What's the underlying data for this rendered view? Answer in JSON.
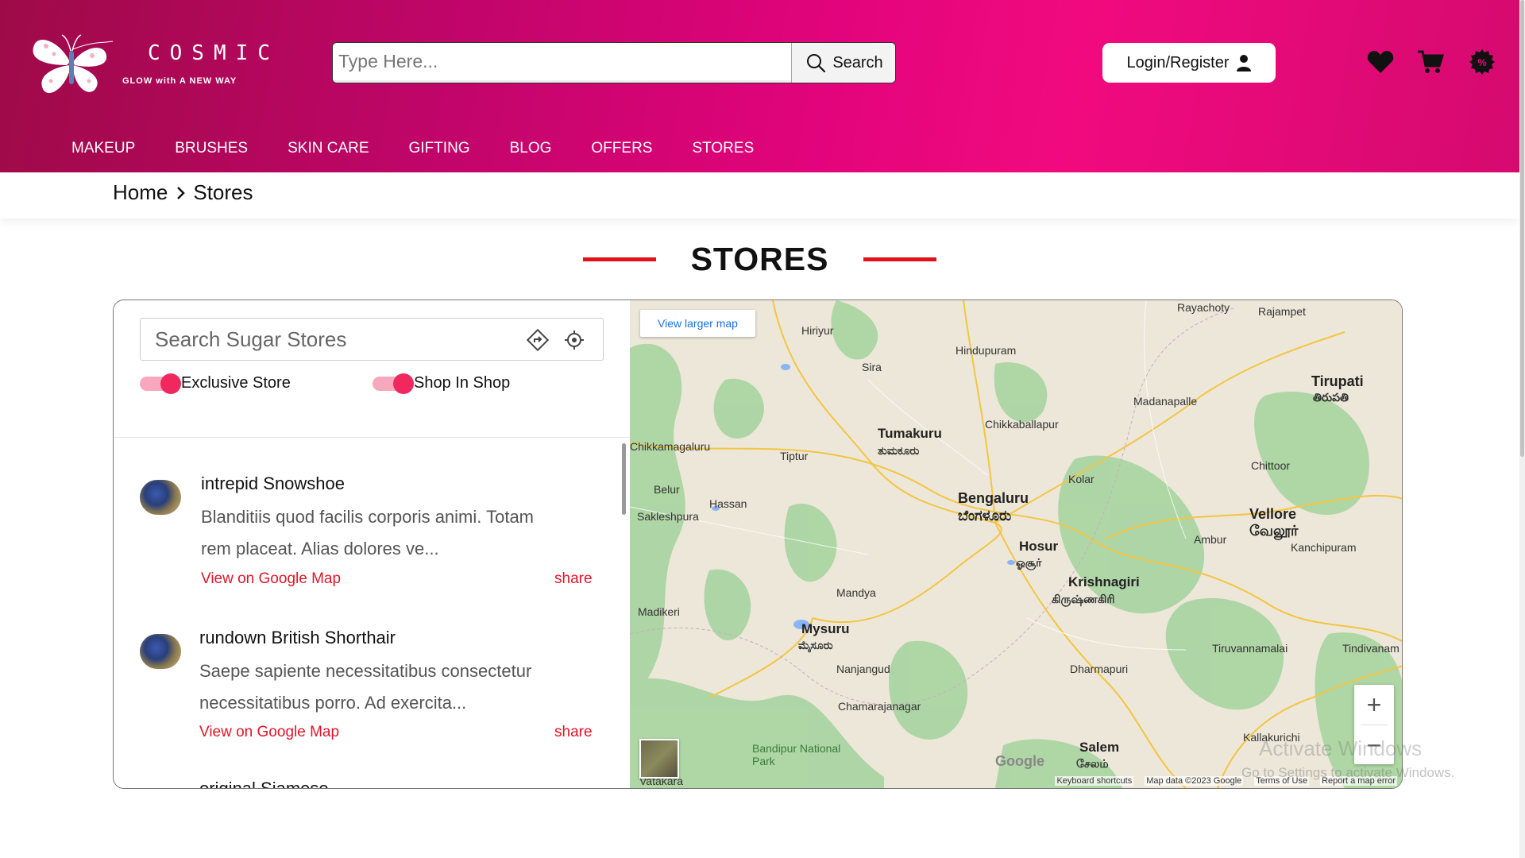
{
  "brand": {
    "name": "COSMIC",
    "tagline": "GLOW with A NEW WAY"
  },
  "header": {
    "search_placeholder": "Type Here...",
    "search_button": "Search",
    "login_label": "Login/Register",
    "icons": [
      "heart-icon",
      "cart-icon",
      "offer-percent-icon"
    ]
  },
  "nav": {
    "items": [
      "MAKEUP",
      "BRUSHES",
      "SKIN CARE",
      "GIFTING",
      "BLOG",
      "OFFERS",
      "STORES"
    ]
  },
  "breadcrumb": {
    "home": "Home",
    "current": "Stores"
  },
  "page": {
    "title": "STORES"
  },
  "store_panel": {
    "search_placeholder": "Search Sugar Stores",
    "toggles": [
      {
        "label": "Exclusive Store",
        "on": true
      },
      {
        "label": "Shop In Shop",
        "on": true
      }
    ],
    "stores": [
      {
        "name": "intrepid Snowshoe",
        "description": "Blanditiis quod facilis corporis animi. Totam rem placeat. Alias dolores ve...",
        "map_link": "View on Google Map",
        "share": "share"
      },
      {
        "name": "rundown British Shorthair",
        "description": "Saepe sapiente necessitatibus consectetur necessitatibus porro. Ad exercita...",
        "map_link": "View on Google Map",
        "share": "share"
      }
    ],
    "partial_next_store": "original Siamese"
  },
  "map": {
    "view_larger": "View larger map",
    "labels": {
      "bengaluru": "Bengaluru",
      "bengaluru_local": "ಬೆಂಗಳೂರು",
      "tumakuru": "Tumakuru",
      "tumakuru_local": "ತುಮಕೂರು",
      "hosur": "Hosur",
      "hosur_local": "ஓசூர்",
      "krishnagiri": "Krishnagiri",
      "krishnagiri_local": "கிருஷ்ணகிரி",
      "mysuru": "Mysuru",
      "mysuru_local": "ಮೈಸೂರು",
      "vellore": "Vellore",
      "vellore_local": "வேலூர்",
      "tirupati": "Tirupati",
      "tirupati_local": "తిరుపతి",
      "salem": "Salem",
      "salem_local": "சேலம்",
      "hiriyur": "Hiriyur",
      "hindupuram": "Hindupuram",
      "chikkaballapur": "Chikkaballapur",
      "kolar": "Kolar",
      "madanapalle": "Madanapalle",
      "tiptur": "Tiptur",
      "hassan": "Hassan",
      "chikkamagaluru": "Chikkamagaluru",
      "mandya": "Mandya",
      "madikeri": "Madikeri",
      "nanjangud": "Nanjangud",
      "chamarajanagar": "Chamarajanagar",
      "dharmapuri": "Dharmapuri",
      "ambur": "Ambur",
      "chittoor": "Chittoor",
      "kanchipuram": "Kanchipuram",
      "tiruvannamalai": "Tiruvannamalai",
      "tindivanam": "Tindivanam",
      "kallakurichi": "Kallakurichi",
      "bandipur": "Bandipur National Park",
      "rayachoty": "Rayachoty",
      "rajampet": "Rajampet",
      "belur": "Belur",
      "sakleshpura": "Sakleshpura",
      "sira": "Sira",
      "vatakara": "Vatakara"
    },
    "footer": [
      "Keyboard shortcuts",
      "Map data ©2023 Google",
      "Terms of Use",
      "Report a map error"
    ]
  },
  "watermark": {
    "line1": "Activate Windows",
    "line2": "Go to Settings to activate Windows."
  },
  "colors": {
    "header_gradient_start": "#9e0a48",
    "header_gradient_mid": "#f10a7f",
    "accent_red": "#e3142a",
    "toggle_on": "#f0285f"
  }
}
